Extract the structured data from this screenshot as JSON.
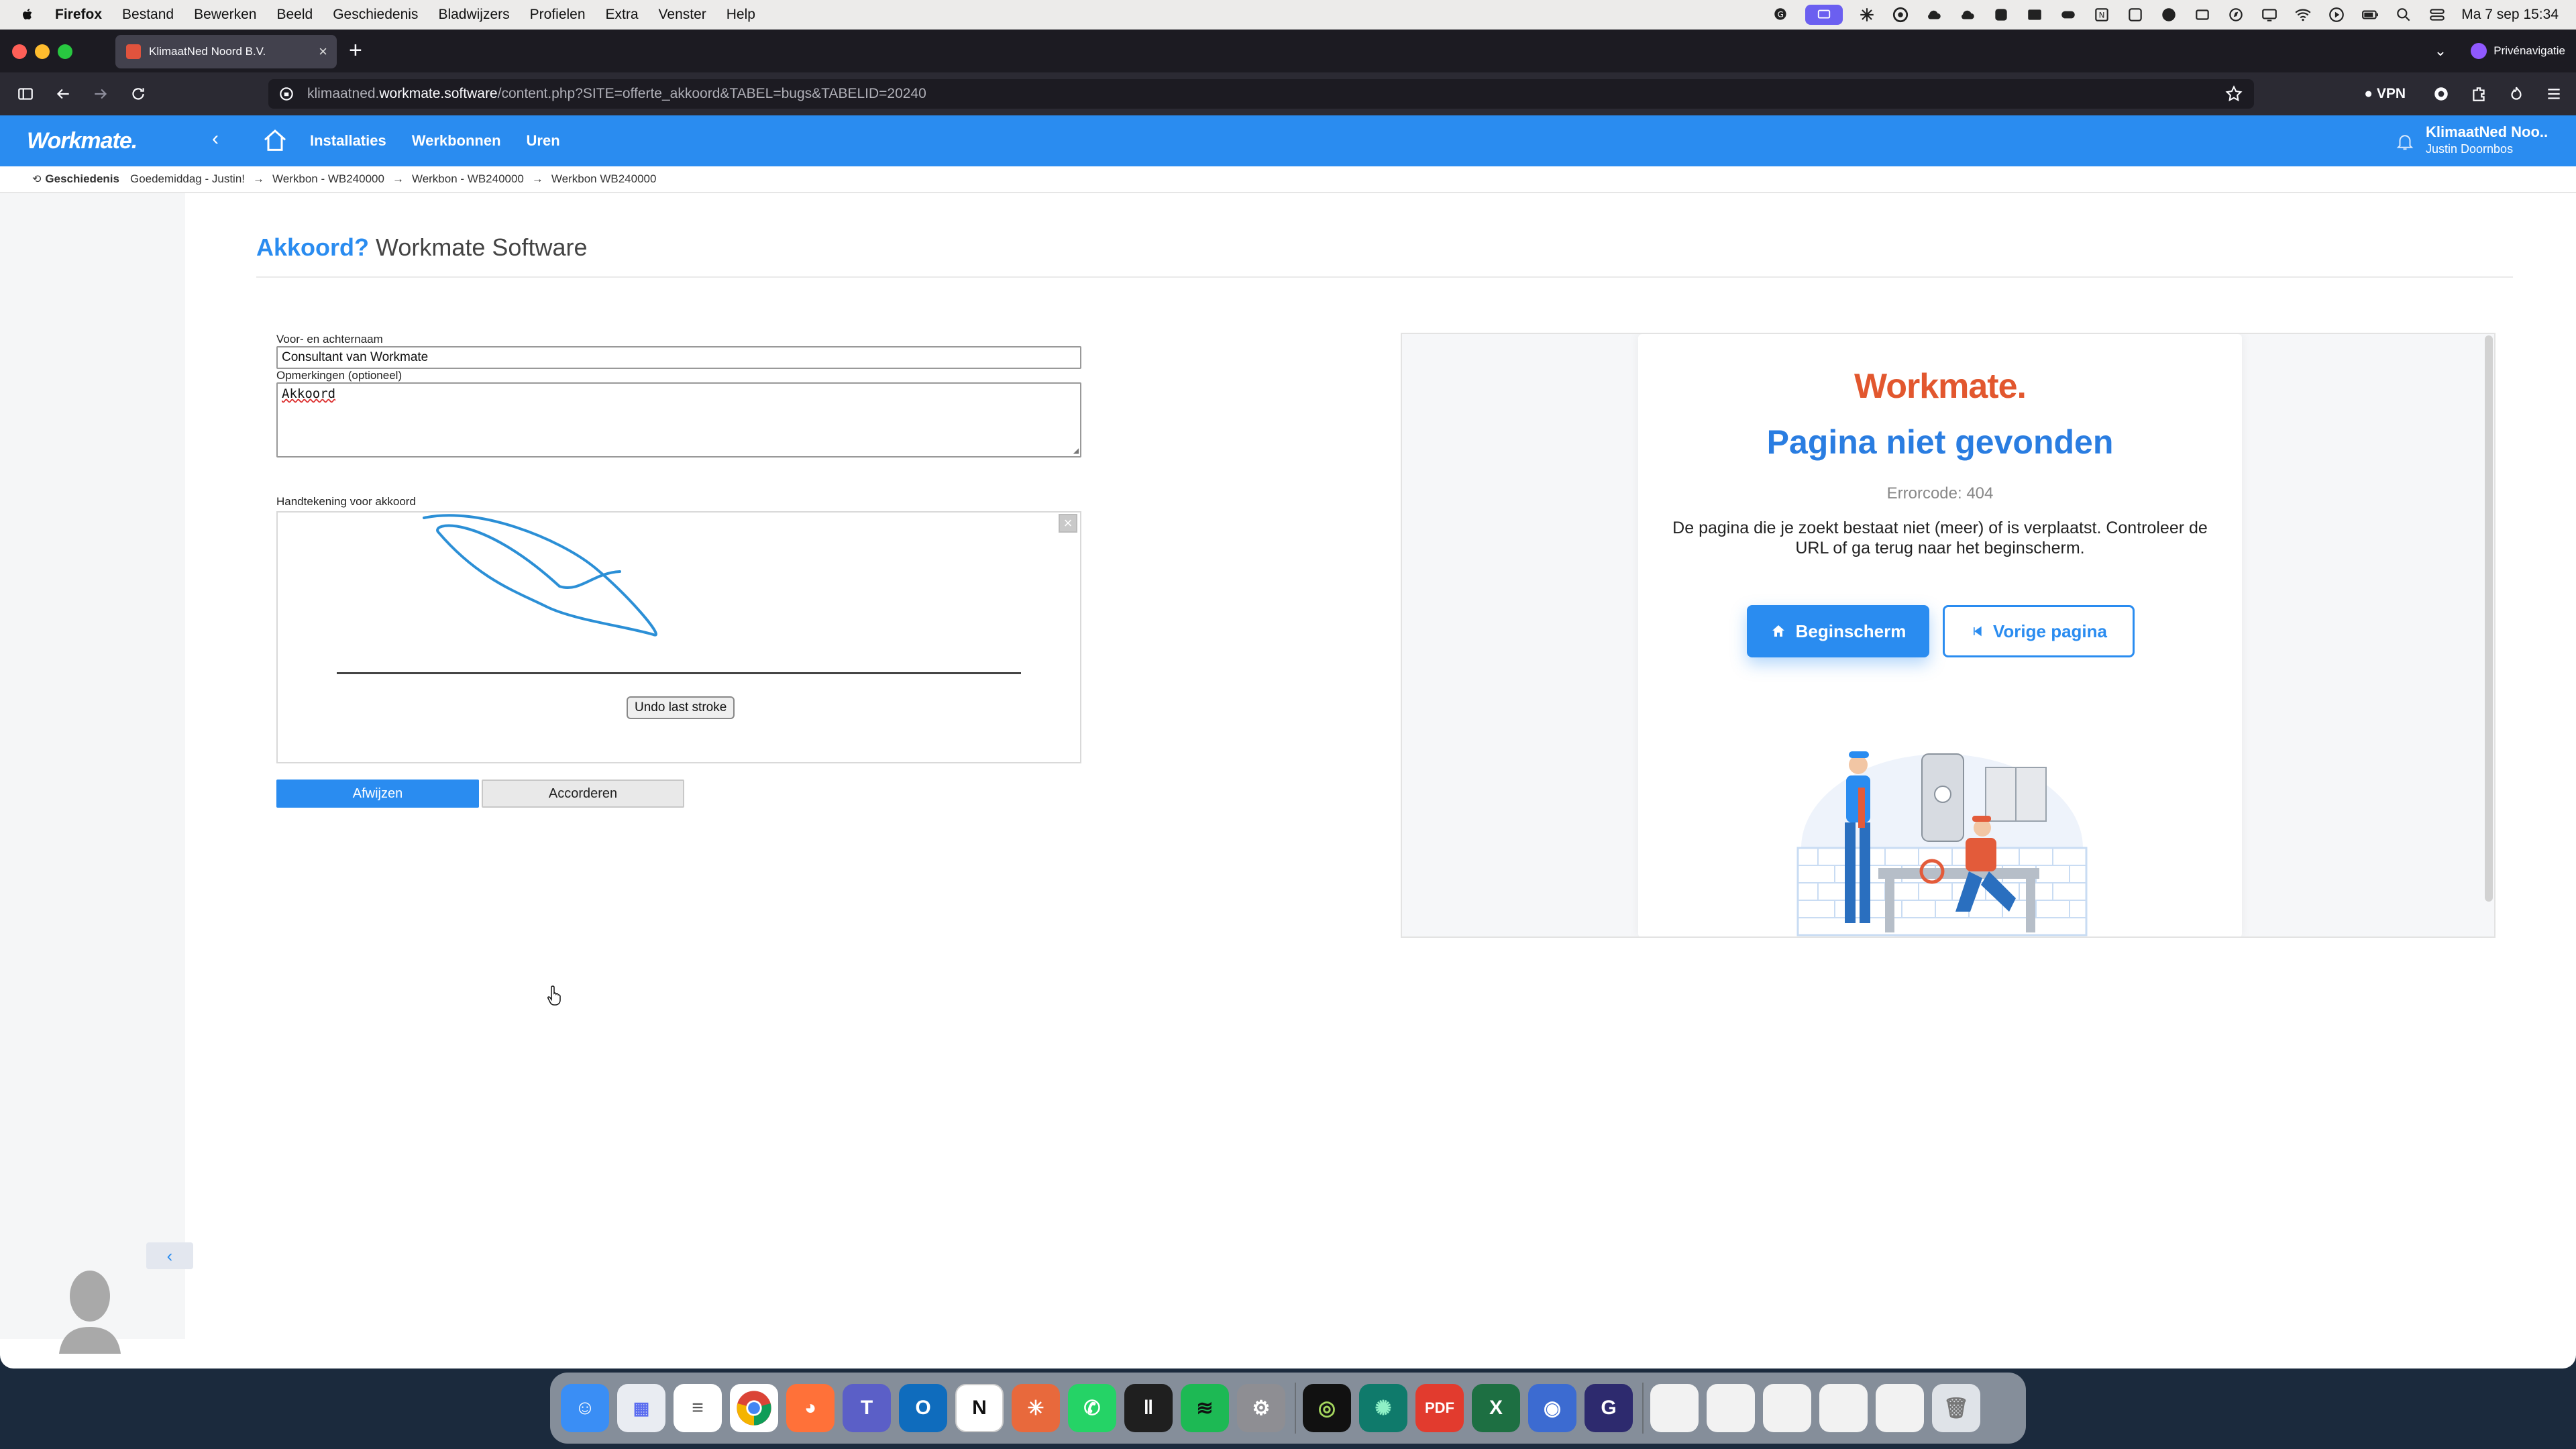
{
  "menubar": {
    "app": "Firefox",
    "items": [
      "Bestand",
      "Bewerken",
      "Beeld",
      "Geschiedenis",
      "Bladwijzers",
      "Profielen",
      "Extra",
      "Venster",
      "Help"
    ],
    "clock": "Ma 7 sep  15:34"
  },
  "browser": {
    "tab_title": "KlimaatNed Noord B.V.",
    "private_label": "Privénavigatie",
    "url_prefix": "klimaatned.",
    "url_host": "workmate.software",
    "url_path": "/content.php?SITE=offerte_akkoord&TABEL=bugs&TABELID=20240",
    "vpn_label": "VPN"
  },
  "app": {
    "logo": "Workmate.",
    "menu": [
      "Installaties",
      "Werkbonnen",
      "Uren"
    ],
    "org": "KlimaatNed Noo..",
    "user": "Justin Doornbos"
  },
  "breadcrumb": {
    "history": "Geschiedenis",
    "crumbs": [
      "Goedemiddag - Justin!",
      "→",
      "Werkbon - WB240000",
      "→",
      "Werkbon - WB240000",
      "→",
      "Werkbon WB240000"
    ]
  },
  "page": {
    "title_accent": "Akkoord?",
    "title_rest": "Workmate Software"
  },
  "form": {
    "name_label": "Voor- en achternaam",
    "name_value": "Consultant van Workmate",
    "remarks_label": "Opmerkingen (optioneel)",
    "remarks_value": "Akkoord",
    "signature_label": "Handtekening voor akkoord",
    "undo_label": "Undo last stroke",
    "reject_label": "Afwijzen",
    "accept_label": "Accorderen"
  },
  "error_card": {
    "logo": "Workmate.",
    "title": "Pagina niet gevonden",
    "code": "Errorcode: 404",
    "message": "De pagina die je zoekt bestaat niet (meer) of is verplaatst. Controleer de URL of ga terug naar het beginscherm.",
    "home_button": "Beginscherm",
    "back_button": "Vorige pagina"
  },
  "colors": {
    "brand_blue": "#2a8cf0",
    "logo_orange": "#e2572e"
  },
  "dock_apps": [
    "finder-icon",
    "launchpad-icon",
    "reminders-icon",
    "chrome-icon",
    "firefox-icon",
    "teams-icon",
    "outlook-icon",
    "notion-icon",
    "claude-icon",
    "whatsapp-icon",
    "audio-icon",
    "spotify-icon",
    "settings-icon",
    "app-icon",
    "app-icon",
    "pdf-icon",
    "excel-icon",
    "app-icon",
    "app-icon",
    "trash-icon"
  ]
}
